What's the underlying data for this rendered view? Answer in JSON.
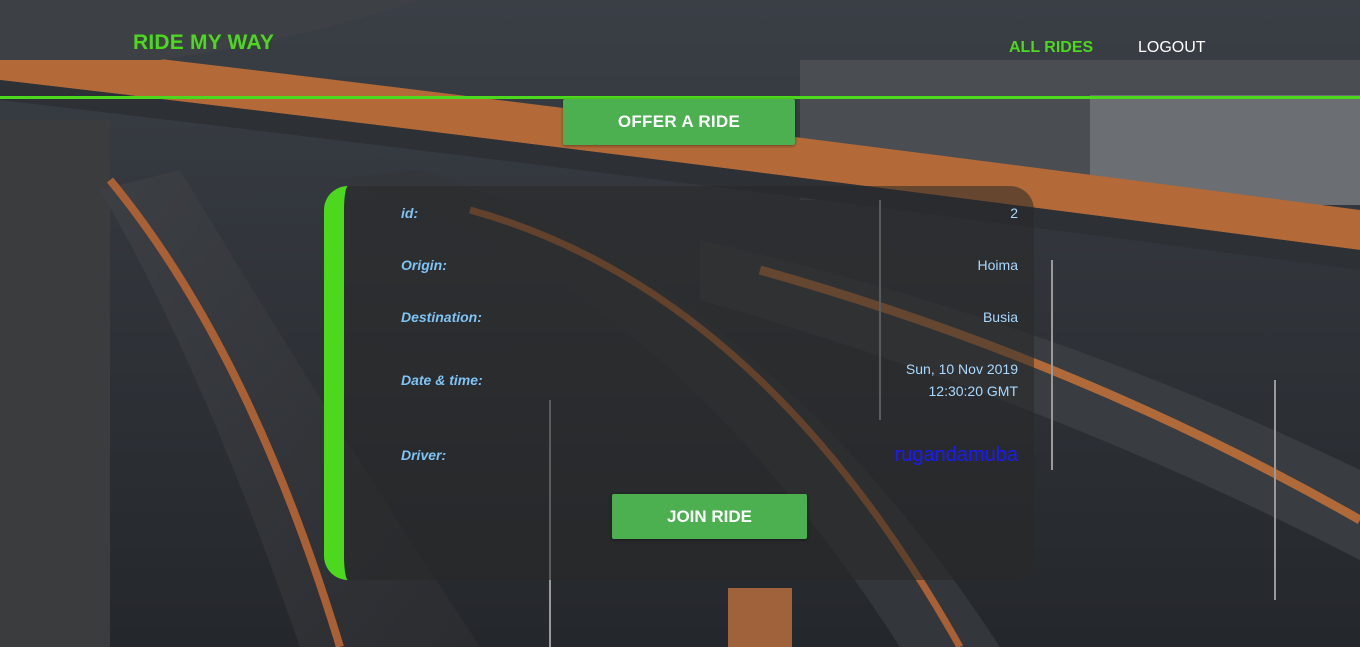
{
  "navbar": {
    "brand": "RIDE MY WAY",
    "links": {
      "all_rides": "ALL RIDES",
      "logout": "LOGOUT"
    },
    "accent_color": "#4cd81d"
  },
  "actions": {
    "offer_ride_label": "OFFER A RIDE"
  },
  "ride": {
    "fields": {
      "id": {
        "label": "id:",
        "value": "2"
      },
      "origin": {
        "label": "Origin:",
        "value": "Hoima"
      },
      "destination": {
        "label": "Destination:",
        "value": "Busia"
      },
      "datetime": {
        "label": "Date & time:",
        "date": "Sun, 10 Nov 2019",
        "time": "12:30:20 GMT"
      },
      "driver": {
        "label": "Driver:",
        "value": "rugandamuba"
      }
    },
    "join_label": "JOIN RIDE",
    "button_color": "#4caf50"
  }
}
